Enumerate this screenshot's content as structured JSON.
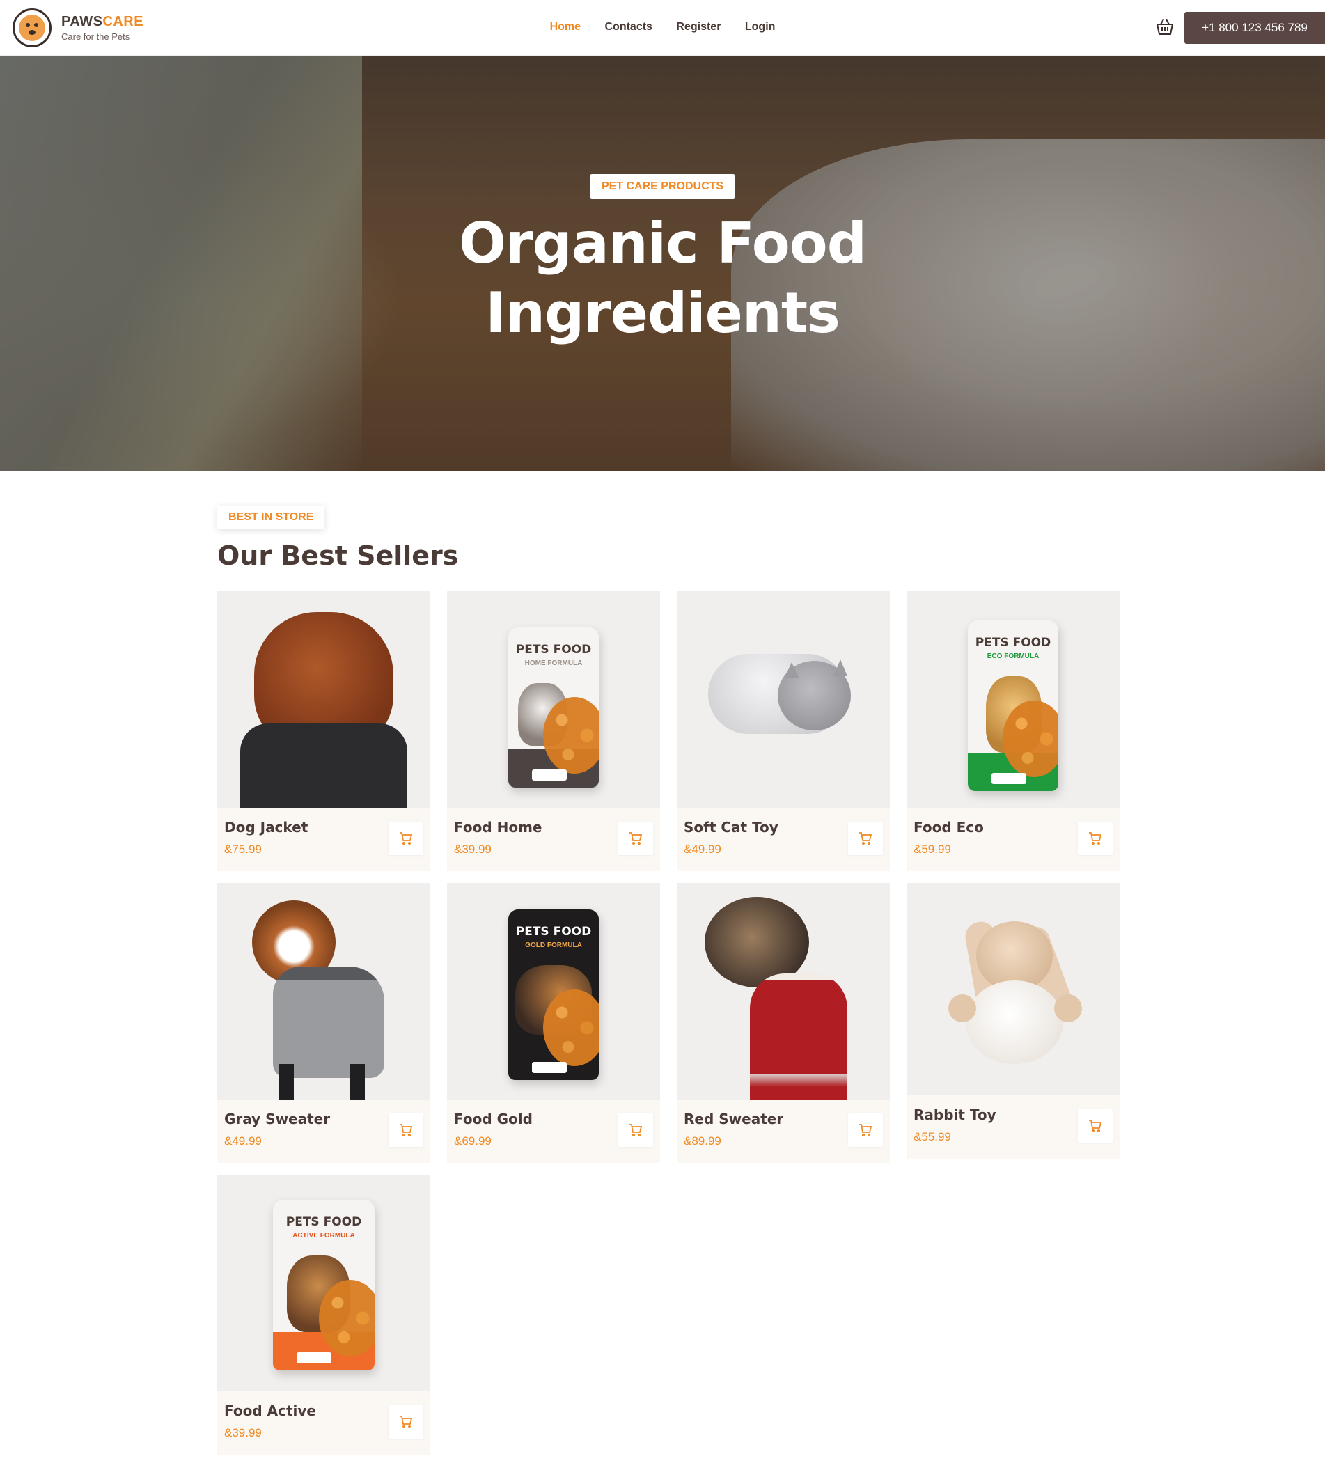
{
  "brand": {
    "name_part1": "PAWS",
    "name_part2": "CARE",
    "tagline": "Care for the Pets"
  },
  "nav": [
    {
      "label": "Home",
      "active": true
    },
    {
      "label": "Contacts",
      "active": false
    },
    {
      "label": "Register",
      "active": false
    },
    {
      "label": "Login",
      "active": false
    }
  ],
  "header": {
    "cart_icon": "basket-icon",
    "phone": "+1 800 123 456 789"
  },
  "hero": {
    "badge": "PET CARE PRODUCTS",
    "title_line1": "Organic Food",
    "title_line2": "Ingredients"
  },
  "best_sellers": {
    "badge": "BEST IN STORE",
    "title": "Our Best Sellers",
    "products": [
      {
        "name": "Dog Jacket",
        "price": "&75.99"
      },
      {
        "name": "Food Home",
        "price": "&39.99"
      },
      {
        "name": "Soft Cat Toy",
        "price": "&49.99"
      },
      {
        "name": "Food Eco",
        "price": "&59.99"
      },
      {
        "name": "Gray Sweater",
        "price": "&49.99"
      },
      {
        "name": "Food Gold",
        "price": "&69.99"
      },
      {
        "name": "Red Sweater",
        "price": "&89.99"
      },
      {
        "name": "Rabbit Toy",
        "price": "&55.99"
      },
      {
        "name": "Food Active",
        "price": "&39.99"
      }
    ],
    "pouch_labels": {
      "pets_food": "PETS FOOD",
      "home": "HOME FORMULA",
      "eco": "ECO FORMULA",
      "gold": "GOLD FORMULA",
      "active": "ACTIVE FORMULA"
    }
  },
  "colors": {
    "accent": "#f08a24",
    "dark": "#4a3b37",
    "phone_bg": "#5a4744",
    "card_bg": "#fbf8f4"
  }
}
